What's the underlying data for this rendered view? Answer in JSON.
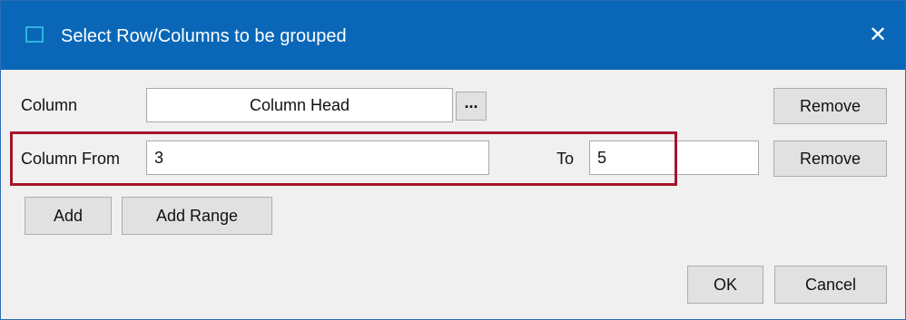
{
  "window": {
    "title": "Select Row/Columns to be grouped",
    "app_icon": "window-icon",
    "close_icon": "close-icon",
    "close_glyph": "✕",
    "title_bar_color": "#0a67b8"
  },
  "row1": {
    "label": "Column",
    "field_value": "Column Head",
    "browse_label": "...",
    "remove_label": "Remove"
  },
  "row2": {
    "label_from": "Column From",
    "from_value": "3",
    "label_to": "To",
    "to_value": "5",
    "remove_label": "Remove",
    "highlight_color": "#a3162b"
  },
  "actions": {
    "add_label": "Add",
    "add_range_label": "Add Range"
  },
  "footer": {
    "ok_label": "OK",
    "cancel_label": "Cancel"
  }
}
